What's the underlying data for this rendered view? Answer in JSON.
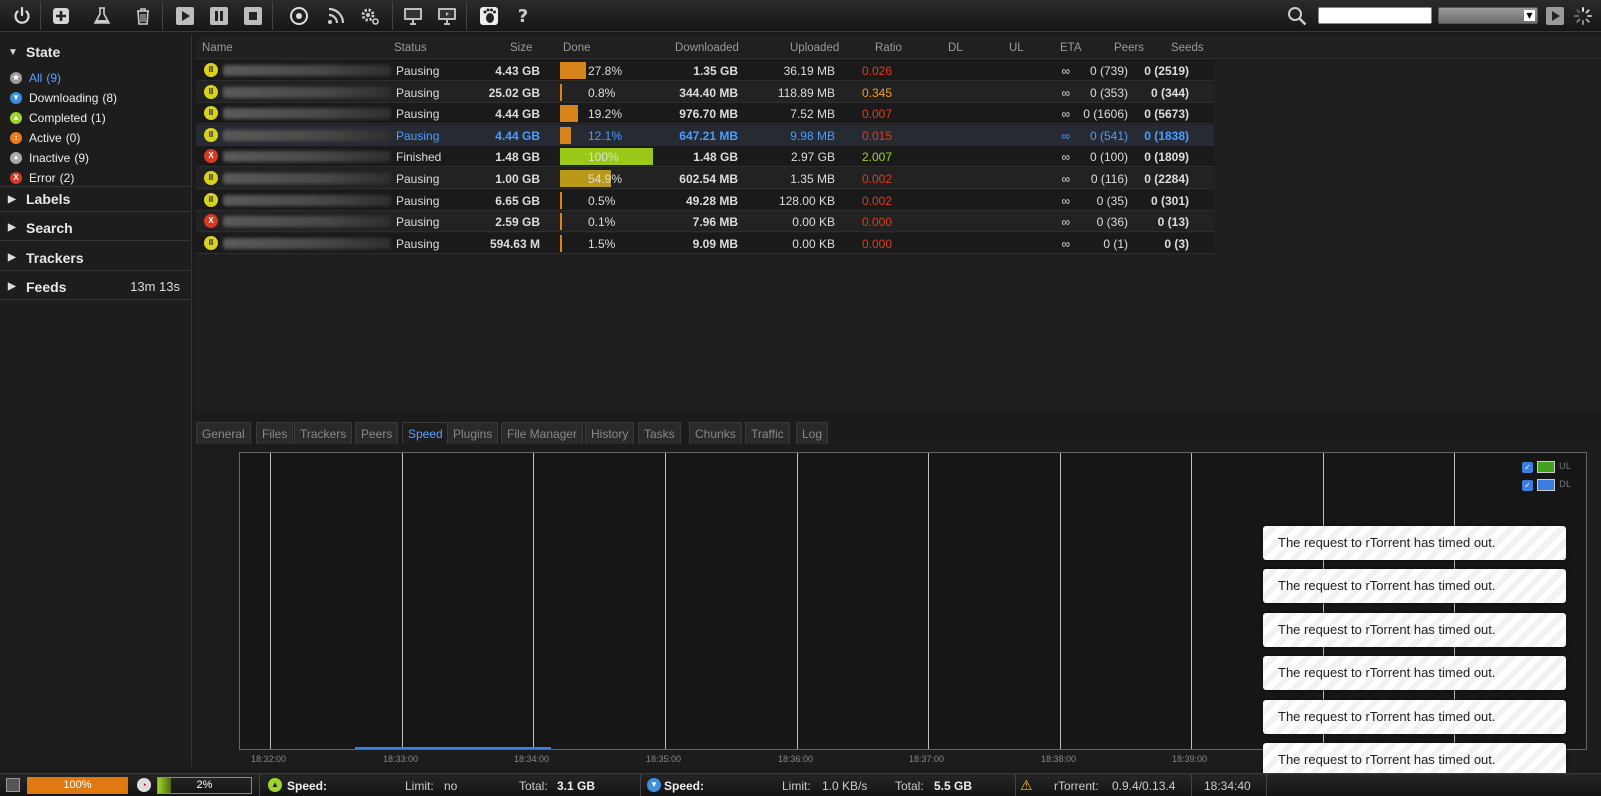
{
  "toolbar": {
    "icons": [
      "power-icon",
      "add-icon",
      "create-icon",
      "remove-icon",
      "start-icon",
      "pause-icon",
      "stop-icon",
      "rss-icon-circle",
      "rss-feed-icon",
      "settings-icon",
      "screen-icon",
      "screen-share-icon",
      "gnome-foot-icon",
      "help-icon",
      "search-icon",
      "spinner-icon"
    ],
    "help_label": "?",
    "search": {
      "value": "",
      "placeholder": ""
    }
  },
  "sidebar": {
    "state_header": "State",
    "states": [
      {
        "label": "All",
        "count": "(9)",
        "color": "#9a9a9a",
        "glyph": "★",
        "selected": true
      },
      {
        "label": "Downloading",
        "count": "(8)",
        "color": "#3a8fe0",
        "glyph": "▼"
      },
      {
        "label": "Completed",
        "count": "(1)",
        "color": "#9fd42a",
        "glyph": "▲"
      },
      {
        "label": "Active",
        "count": "(0)",
        "color": "#ea7b1e",
        "glyph": "↕"
      },
      {
        "label": "Inactive",
        "count": "(9)",
        "color": "#aaaaaa",
        "glyph": "●"
      },
      {
        "label": "Error",
        "count": "(2)",
        "color": "#d63a22",
        "glyph": "X"
      }
    ],
    "labels_header": "Labels",
    "search_header": "Search",
    "trackers_header": "Trackers",
    "feeds_header": "Feeds",
    "feeds_timer": "13m 13s"
  },
  "list": {
    "columns": [
      "Name",
      "Status",
      "Size",
      "Done",
      "Downloaded",
      "Uploaded",
      "Ratio",
      "DL",
      "UL",
      "ETA",
      "Peers",
      "Seeds"
    ],
    "rows": [
      {
        "state": "pause",
        "status": "Pausing",
        "size": "4.43 GB",
        "done": 0.278,
        "done_text": "27.8%",
        "downloaded": "1.35 GB",
        "uploaded": "36.19 MB",
        "ratio": "0.026",
        "ratio_class": "ratio-red",
        "eta": "∞",
        "peers": "0 (739)",
        "seeds": "0 (2519)"
      },
      {
        "state": "pause",
        "status": "Pausing",
        "size": "25.02 GB",
        "done": 0.008,
        "done_text": "0.8%",
        "downloaded": "344.40 MB",
        "uploaded": "118.89 MB",
        "ratio": "0.345",
        "ratio_class": "ratio-org",
        "eta": "∞",
        "peers": "0 (353)",
        "seeds": "0 (344)"
      },
      {
        "state": "pause",
        "status": "Pausing",
        "size": "4.44 GB",
        "done": 0.192,
        "done_text": "19.2%",
        "downloaded": "976.70 MB",
        "uploaded": "7.52 MB",
        "ratio": "0.007",
        "ratio_class": "ratio-red",
        "eta": "∞",
        "peers": "0 (1606)",
        "seeds": "0 (5673)"
      },
      {
        "state": "pause",
        "status": "Pausing",
        "size": "4.44 GB",
        "done": 0.121,
        "done_text": "12.1%",
        "downloaded": "647.21 MB",
        "uploaded": "9.98 MB",
        "ratio": "0.015",
        "ratio_class": "ratio-red",
        "eta": "∞",
        "peers": "0 (541)",
        "seeds": "0 (1838)",
        "selected": true
      },
      {
        "state": "err",
        "status": "Finished",
        "size": "1.48 GB",
        "done": 1.0,
        "done_text": "100%",
        "downloaded": "1.48 GB",
        "uploaded": "2.97 GB",
        "ratio": "2.007",
        "ratio_class": "ratio-grn",
        "eta": "∞",
        "peers": "0 (100)",
        "seeds": "0 (1809)"
      },
      {
        "state": "pause",
        "status": "Pausing",
        "size": "1.00 GB",
        "done": 0.549,
        "done_text": "54.9%",
        "downloaded": "602.54 MB",
        "uploaded": "1.35 MB",
        "ratio": "0.002",
        "ratio_class": "ratio-red",
        "eta": "∞",
        "peers": "0 (116)",
        "seeds": "0 (2284)"
      },
      {
        "state": "pause",
        "status": "Pausing",
        "size": "6.65 GB",
        "done": 0.005,
        "done_text": "0.5%",
        "downloaded": "49.28 MB",
        "uploaded": "128.00 KB",
        "ratio": "0.002",
        "ratio_class": "ratio-red",
        "eta": "∞",
        "peers": "0 (35)",
        "seeds": "0 (301)"
      },
      {
        "state": "err",
        "status": "Pausing",
        "size": "2.59 GB",
        "done": 0.001,
        "done_text": "0.1%",
        "downloaded": "7.96 MB",
        "uploaded": "0.00 KB",
        "ratio": "0.000",
        "ratio_class": "ratio-red",
        "eta": "∞",
        "peers": "0 (36)",
        "seeds": "0 (13)"
      },
      {
        "state": "pause",
        "status": "Pausing",
        "size": "594.63 M",
        "done": 0.015,
        "done_text": "1.5%",
        "downloaded": "9.09 MB",
        "uploaded": "0.00 KB",
        "ratio": "0.000",
        "ratio_class": "ratio-red",
        "eta": "∞",
        "peers": "0 (1)",
        "seeds": "0 (3)"
      }
    ]
  },
  "tabs": [
    "General",
    "Files",
    "Trackers",
    "Peers",
    "Speed",
    "Plugins",
    "File Manager",
    "History",
    "Tasks",
    "Chunks",
    "Traffic",
    "Log"
  ],
  "active_tab": "Speed",
  "graph": {
    "legend": [
      {
        "name": "UL",
        "color": "#3fa31e"
      },
      {
        "name": "DL",
        "color": "#3a7ee0"
      }
    ],
    "x_ticks": [
      "18:32:00",
      "18:33:00",
      "18:34:00",
      "18:35:00",
      "18:36:00",
      "18:37:00",
      "18:38:00",
      "18:39:00"
    ]
  },
  "toasts": [
    "The request to rTorrent has timed out.",
    "The request to rTorrent has timed out.",
    "The request to rTorrent has timed out.",
    "The request to rTorrent has timed out.",
    "The request to rTorrent has timed out.",
    "The request to rTorrent has timed out."
  ],
  "status": {
    "disk_percent": "100%",
    "cpu_percent": "2%",
    "ul_speed_label": "Speed:",
    "ul_speed_value": "",
    "ul_limit_label": "Limit:",
    "ul_limit_value": "no",
    "ul_total_label": "Total:",
    "ul_total_value": "3.1 GB",
    "dl_speed_label": "Speed:",
    "dl_speed_value": "",
    "dl_limit_label": "Limit:",
    "dl_limit_value": "1.0 KB/s",
    "dl_total_label": "Total:",
    "dl_total_value": "5.5 GB",
    "client_label": "rTorrent:",
    "client_version": "0.9.4/0.13.4",
    "clock": "18:34:40"
  }
}
